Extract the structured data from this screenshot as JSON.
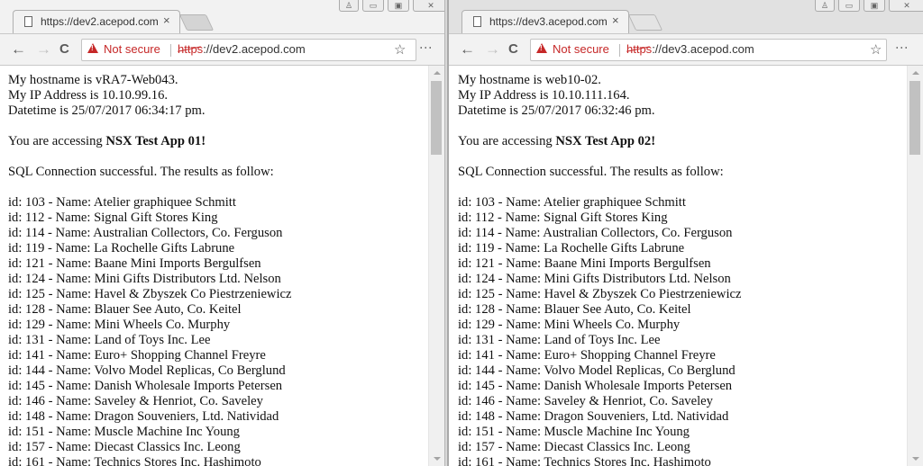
{
  "windows": [
    {
      "tab_title": "https://dev2.acepod.com",
      "security_label": "Not secure",
      "url_scheme": "https",
      "url_rest": "://dev2.acepod.com",
      "page": {
        "hostname_line": "My hostname is vRA7-Web043.",
        "ip_line": "My IP Address is 10.10.99.16.",
        "datetime_line": "Datetime is 25/07/2017 06:34:17 pm.",
        "accessing_prefix": "You are accessing ",
        "app_name": "NSX Test App 01!",
        "sql_line": "SQL Connection successful. The results as follow:"
      }
    },
    {
      "tab_title": "https://dev3.acepod.com",
      "security_label": "Not secure",
      "url_scheme": "https",
      "url_rest": "://dev3.acepod.com",
      "page": {
        "hostname_line": "My hostname is web10-02.",
        "ip_line": "My IP Address is 10.10.111.164.",
        "datetime_line": "Datetime is 25/07/2017 06:32:46 pm.",
        "accessing_prefix": "You are accessing ",
        "app_name": "NSX Test App 02!",
        "sql_line": "SQL Connection successful. The results as follow:"
      }
    }
  ],
  "results": [
    "id: 103 - Name: Atelier graphiquee Schmitt",
    "id: 112 - Name: Signal Gift Stores King",
    "id: 114 - Name: Australian Collectors, Co. Ferguson",
    "id: 119 - Name: La Rochelle Gifts Labrune",
    "id: 121 - Name: Baane Mini Imports Bergulfsen",
    "id: 124 - Name: Mini Gifts Distributors Ltd. Nelson",
    "id: 125 - Name: Havel & Zbyszek Co Piestrzeniewicz",
    "id: 128 - Name: Blauer See Auto, Co. Keitel",
    "id: 129 - Name: Mini Wheels Co. Murphy",
    "id: 131 - Name: Land of Toys Inc. Lee",
    "id: 141 - Name: Euro+ Shopping Channel Freyre",
    "id: 144 - Name: Volvo Model Replicas, Co Berglund",
    "id: 145 - Name: Danish Wholesale Imports Petersen",
    "id: 146 - Name: Saveley & Henriot, Co. Saveley",
    "id: 148 - Name: Dragon Souveniers, Ltd. Natividad",
    "id: 151 - Name: Muscle Machine Inc Young",
    "id: 157 - Name: Diecast Classics Inc. Leong",
    "id: 161 - Name: Technics Stores Inc. Hashimoto"
  ],
  "icons": {
    "back": "←",
    "forward": "→",
    "reload": "C",
    "star": "☆",
    "menu": "⋮",
    "close": "×",
    "profile": "♙",
    "minimize": "▭",
    "maximize": "▣",
    "window_close": "✕"
  }
}
